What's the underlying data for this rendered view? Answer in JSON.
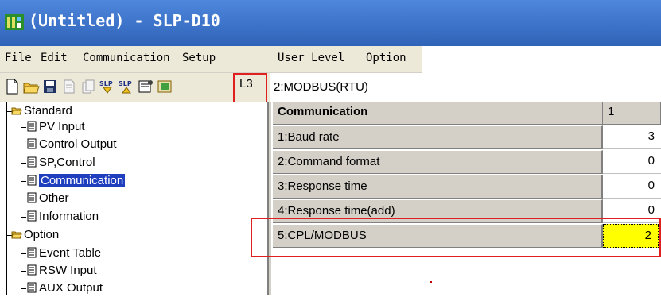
{
  "window": {
    "title": "(Untitled) - SLP-D10"
  },
  "menu": [
    "File",
    "Edit",
    "Communication",
    "Setup",
    "User Level",
    "Option"
  ],
  "toolbar": {
    "icons": [
      "new-file-icon",
      "open-folder-icon",
      "save-icon",
      "print-preview-icon",
      "copy-icon",
      "slp-upload-icon",
      "slp-download-icon",
      "properties-icon",
      "export-icon"
    ],
    "user_level": "L3",
    "protocol": "2:MODBUS(RTU)"
  },
  "tree": {
    "groups": [
      {
        "label": "Standard",
        "items": [
          "PV Input",
          "Control Output",
          "SP,Control",
          "Communication",
          "Other",
          "Information"
        ],
        "selected": "Communication"
      },
      {
        "label": "Option",
        "items": [
          "Event Table",
          "RSW Input",
          "AUX Output"
        ]
      }
    ]
  },
  "grid": {
    "header_label": "Communication",
    "header_col": "1",
    "rows": [
      {
        "label": "1:Baud rate",
        "value": "3"
      },
      {
        "label": "2:Command format",
        "value": "0"
      },
      {
        "label": "3:Response time",
        "value": "0"
      },
      {
        "label": "4:Response time(add)",
        "value": "0"
      },
      {
        "label": "5:CPL/MODBUS",
        "value": "2"
      }
    ]
  },
  "colors": {
    "title_bar": "#3b76d0",
    "selection": "#1f3fbf",
    "highlight_cell": "#ffff00",
    "annotation_box": "#e02020"
  }
}
